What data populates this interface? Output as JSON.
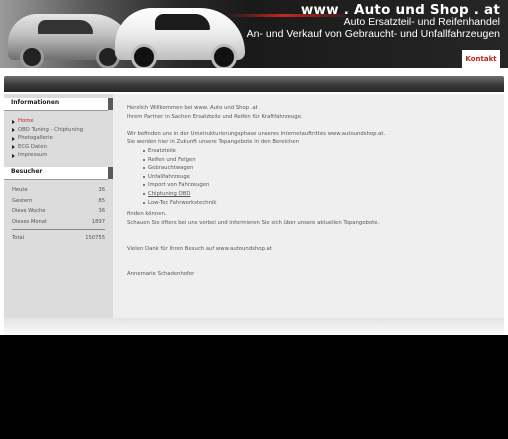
{
  "header": {
    "site_title": "www . Auto und Shop . at",
    "tagline_1": "Auto Ersatzteil- und Reifenhandel",
    "tagline_2": "An- und Verkauf von Gebraucht- und Unfallfahrzeugen",
    "contact_button": "Kontakt"
  },
  "sidebar": {
    "info_title": "Informationen",
    "items": [
      {
        "label": "Home",
        "active": true
      },
      {
        "label": "OBD Tuning - Chiptuning"
      },
      {
        "label": "Photogallerie"
      },
      {
        "label": "ECG Daten"
      },
      {
        "label": "Impressum"
      }
    ],
    "visitors_title": "Besucher",
    "stats": [
      {
        "label": "Heute",
        "value": "36"
      },
      {
        "label": "Gestern",
        "value": "85"
      },
      {
        "label": "Diese Woche",
        "value": "36"
      },
      {
        "label": "Dieses Monat",
        "value": "1897"
      }
    ],
    "total": {
      "label": "Total",
      "value": "150755"
    }
  },
  "content": {
    "welcome": "Herzlich Willkommen bei www. Auto und Shop .at",
    "partner": "Ihrem Partner in Sachen Ersatzteile und Reifen für Kraftfahrzeuge.",
    "restructuring": "Wir befinden uns in der Umstrukturierungsphase unseres Internetauftrittes www.autoundshop.at.",
    "offers_intro": "Sie werden hier in Zukunft unsere Topangebote in den Bereichen",
    "bullets": [
      "Ersatzteile",
      "Reifen und Felgen",
      "Gebrauchtwagen",
      "Unfallfahrzeuge",
      "Import von Fahrzeugen",
      "Chiptuning OBD",
      "Low-Tec Fahrwerkstechnik"
    ],
    "finden": "finden können.",
    "schauen": "Schauen Sie öfters bei uns vorbei und informieren Sie sich über unsere aktuellen Topangebote.",
    "thanks": "Vielen Dank für Ihren Besuch auf www.autoundshop.at",
    "signature": "Annemarie Schadenhofer"
  }
}
